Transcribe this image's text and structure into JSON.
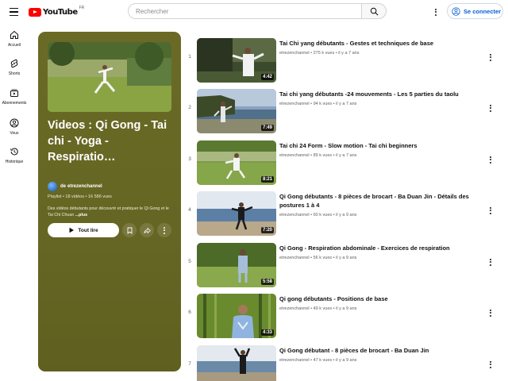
{
  "header": {
    "logo_text": "YouTube",
    "country_code": "FR",
    "search_placeholder": "Rechercher",
    "signin_label": "Se connecter"
  },
  "sidebar": {
    "items": [
      {
        "label": "Accueil",
        "icon": "home-icon"
      },
      {
        "label": "Shorts",
        "icon": "shorts-icon"
      },
      {
        "label": "Abonnements",
        "icon": "subscriptions-icon"
      },
      {
        "label": "Vous",
        "icon": "you-icon"
      },
      {
        "label": "Historique",
        "icon": "history-icon"
      }
    ]
  },
  "playlist": {
    "title": "Videos : Qi Gong - Tai chi - Yoga - Respiratio…",
    "channel_prefix": "de",
    "channel": "etrezenchannel",
    "meta": "Playlist • 18 vidéos • 16 586 vues",
    "description": "Des vidéos débutants pour découvrir et pratiquer le Qi Gong et le Tai Chi Chuan",
    "more_label": "...plus",
    "play_label": "Tout lire",
    "panel_color": "#666624"
  },
  "videos": [
    {
      "index": "1",
      "title": "Tai Chi yang débutants - Gestes et techniques de base",
      "channel": "etrezenchannel",
      "stats": "275 k vues • il y a 7 ans",
      "duration": "4:42"
    },
    {
      "index": "2",
      "title": "Tai chi yang débutants -24 mouvements - Les 5 parties du taolu",
      "channel": "etrezenchannel",
      "stats": "94 k vues • il y a 7 ans",
      "duration": "7:49"
    },
    {
      "index": "3",
      "title": "Tai chi 24 Form - Slow motion - Tai chi beginners",
      "channel": "etrezenchannel",
      "stats": "89 k vues • il y a 7 ans",
      "duration": "8:21"
    },
    {
      "index": "4",
      "title": "Qi Gong débutants - 8 pièces de brocart - Ba Duan Jin - Détails des postures 1 à 4",
      "channel": "etrezenchannel",
      "stats": "60 k vues • il y a 9 ans",
      "duration": "7:20"
    },
    {
      "index": "5",
      "title": "Qi Gong - Respiration abdominale - Exercices de respiration",
      "channel": "etrezenchannel",
      "stats": "56 k vues • il y a 9 ans",
      "duration": "5:58"
    },
    {
      "index": "6",
      "title": "Qi gong débutants - Positions de base",
      "channel": "etrezenchannel",
      "stats": "49 k vues • il y a 9 ans",
      "duration": "4:33"
    },
    {
      "index": "7",
      "title": "Qi Gong débutant - 8 pièces de brocart - Ba Duan Jin",
      "channel": "etrezenchannel",
      "stats": "47 k vues • il y a 9 ans",
      "duration": ""
    }
  ]
}
